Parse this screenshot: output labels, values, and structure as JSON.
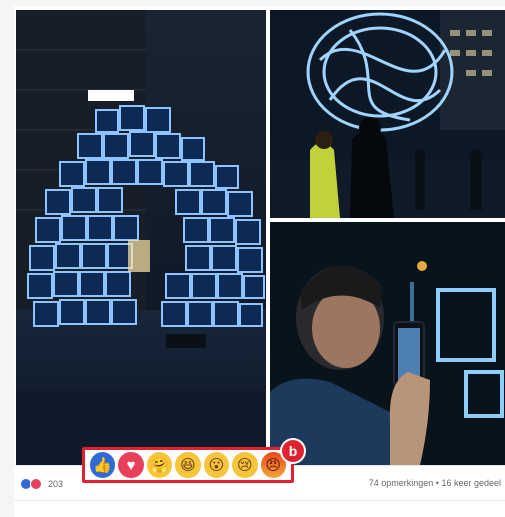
{
  "post": {
    "reaction_count": "203",
    "comments_shares": "74 opmerkingen • 16 keer gedeel"
  },
  "reaction_bar": {
    "items": [
      {
        "name": "like",
        "glyph": "👍"
      },
      {
        "name": "love",
        "glyph": "♥"
      },
      {
        "name": "care",
        "glyph": "🤗"
      },
      {
        "name": "haha",
        "glyph": "😆"
      },
      {
        "name": "wow",
        "glyph": "😮"
      },
      {
        "name": "sad",
        "glyph": "😢"
      },
      {
        "name": "angry",
        "glyph": "😠"
      }
    ],
    "callout_label": "b"
  },
  "colors": {
    "highlight": "#e0212f",
    "like": "#2f6bd6",
    "love": "#e8405a",
    "emoji_yellow": "#f7c53b"
  }
}
